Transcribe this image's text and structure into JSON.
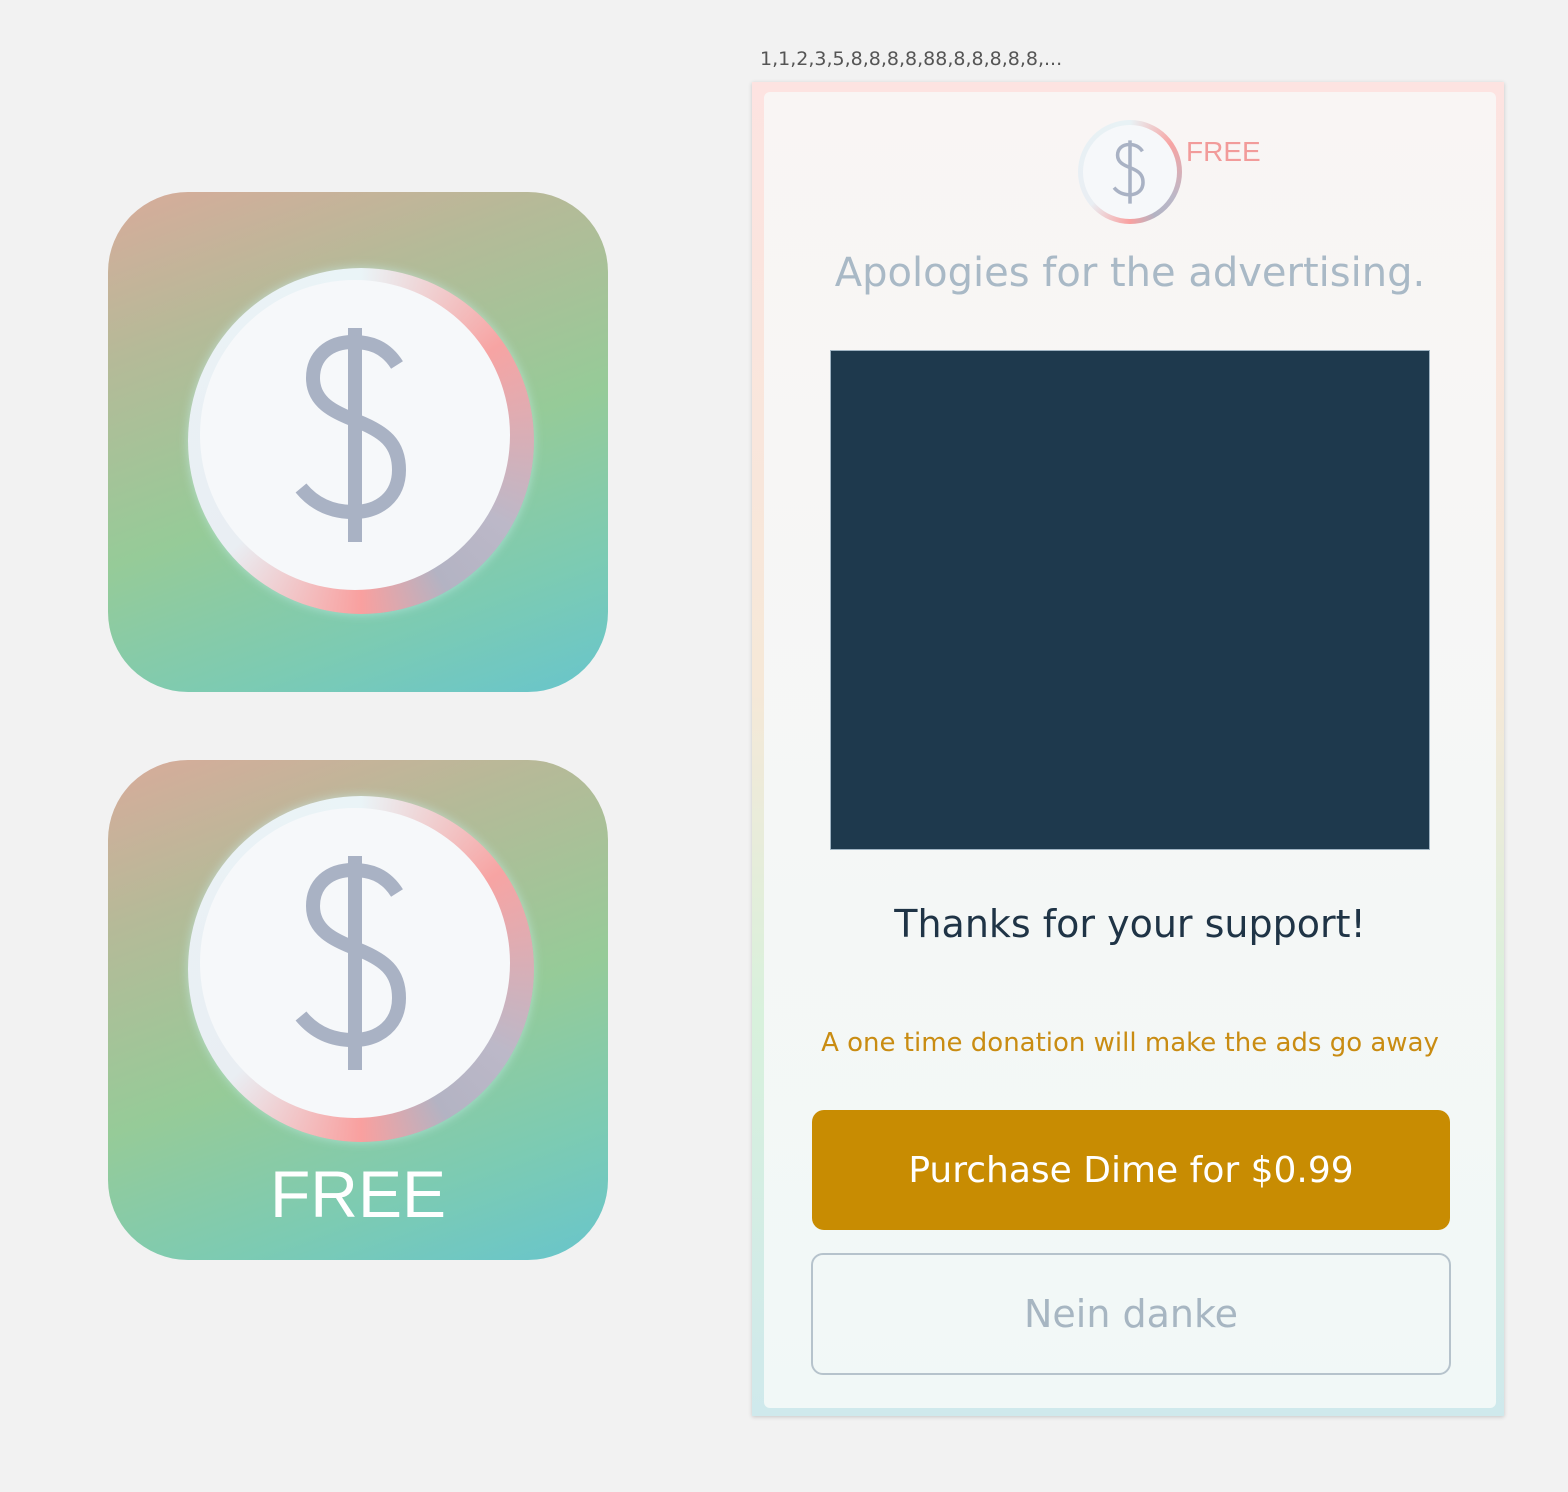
{
  "icons": [
    {
      "name": "app-icon",
      "symbol_icon": "dollar-icon"
    },
    {
      "name": "app-icon-free",
      "symbol_icon": "dollar-icon",
      "label": "FREE"
    }
  ],
  "sequence_text": "1,1,2,3,5,8,8,8,8,88,8,8,8,8,8,...",
  "dialog": {
    "badge_icon": "dollar-icon",
    "badge_label": "FREE",
    "headline": "Apologies for the advertising.",
    "thanks": "Thanks for your support!",
    "donation_note": "A one time donation will make the ads go away",
    "purchase_label": "Purchase Dime for $0.99",
    "decline_label": "Nein danke"
  },
  "colors": {
    "background": "#f2f2f2",
    "ad_placeholder": "#1e394d",
    "purchase_button": "#c88c02",
    "donation_note": "#c98c12",
    "free_badge": "#f29b9a",
    "dollar_glyph": "#a9b2c4"
  }
}
